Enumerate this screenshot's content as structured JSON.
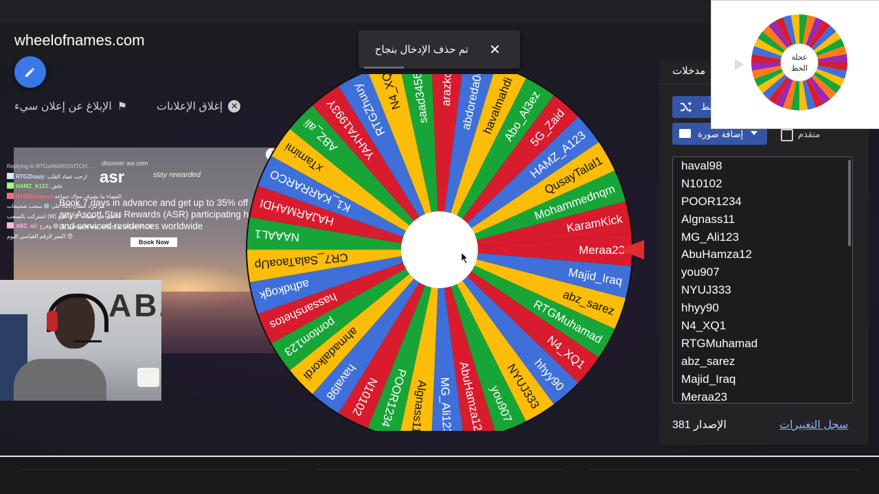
{
  "site": {
    "name": "wheelofnames.com"
  },
  "toast": {
    "message": "تم حذف الإدخال بنجاح",
    "close": "✕"
  },
  "ads": {
    "report_label": "الإبلاغ عن إعلان سيء",
    "close_label": "إغلاق الإعلانات",
    "banner": {
      "logo_line": "discover asr.com",
      "logo": "asr",
      "tagline": "stay rewarded",
      "headline": "Book 7 days in advance and get up to 35% off at any Ascott Star Rewards (ASR) participating hotels and serviced residences worldwide",
      "cta": "Book Now",
      "info": "i"
    }
  },
  "chat": [
    {
      "user": "",
      "text": "Replying to RTGxAMAROVITCH: ...",
      "color": "#cfcfcf"
    },
    {
      "user": "RTGZhuuy:",
      "text": "ارحب عماد القلب",
      "color": "#cfe9ff"
    },
    {
      "user": "HAMZ_A123:",
      "text": "عاش",
      "color": "#9bff7a"
    },
    {
      "user": "RTGMuhamad",
      "text": "الفضاء ما بشوف معاك جماعة",
      "color": "#ff6e6e"
    },
    {
      "user": "",
      "text": "كم مرة عشان 325 على 😄 سحب صحيحات",
      "color": "#ffffff"
    },
    {
      "user": "",
      "text": "اشتركت بالسحب (W) لا اعتبر في طلبات 😍 واكثرو",
      "color": "#ffffff"
    },
    {
      "user": "ABZ_ali:",
      "text": "كان الاحتراف يربح تالت وبعدها ويتحرر نار 😄 وفرح",
      "color": "#ffb3e6"
    },
    {
      "user": "",
      "text": "اكسر الرقم القياسي اليوم 😍",
      "color": "#ffffff"
    }
  ],
  "wheel": {
    "entries": [
      "Meraa23",
      "Majid_Iraq",
      "abz_sarez",
      "RTGMuhamad",
      "N4_XQ1",
      "hhyy90",
      "NYUJ333",
      "you907",
      "AbuHamza12",
      "MG_Ali123",
      "Algnass11",
      "POOR1234",
      "N10102",
      "haval98",
      "ahmadalkordi",
      "pontom123",
      "hassanshetos",
      "adhdkogk",
      "CR7_SalaTaoaUp",
      "NAAAL1",
      "HAJARMAHDI",
      "K1_KARRARCO",
      "xTamimi",
      "ABZ_ali",
      "YAHYA1993Y",
      "RTGZhuuy",
      "N4_XQ",
      "saad34569",
      "arazko2",
      "abdoreda06",
      "havalmahdi",
      "Abo_Al3ez",
      "5G_Zaid",
      "HAMZ_A123",
      "QusayTalal1",
      "Mohammednqm",
      "KaramKick"
    ],
    "colors": [
      "#d81b2d",
      "#3f6fd8",
      "#fbbd08",
      "#18a538"
    ]
  },
  "panel": {
    "tab_label": "مدخلات",
    "shuffle_label": "خلط",
    "add_image_label": "إضافة صورة",
    "advanced_label": "متقدم",
    "entries": [
      "haval98",
      "N10102",
      "POOR1234",
      "Algnass11",
      "MG_Ali123",
      "AbuHamza12",
      "you907",
      "NYUJ333",
      "hhyy90",
      "N4_XQ1",
      "RTGMuhamad",
      "abz_sarez",
      "Majid_Iraq",
      "Meraa23"
    ],
    "version_label": "الإصدار 381",
    "changelog_label": "سجل التغييرات"
  },
  "preview": {
    "title": "عجلة الحظ"
  }
}
